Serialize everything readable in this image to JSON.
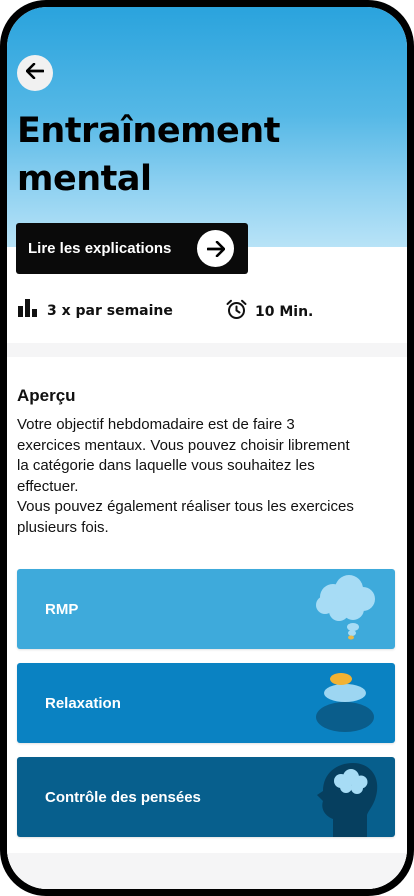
{
  "header": {
    "back_icon": "arrow-left-icon",
    "title": "Entraînement mental",
    "explain_button": {
      "label": "Lire les explications",
      "icon": "arrow-right-icon"
    }
  },
  "stats": [
    {
      "icon": "bar-chart-icon",
      "label": "3 x par semaine"
    },
    {
      "icon": "alarm-clock-icon",
      "label": "10 Min."
    }
  ],
  "overview": {
    "title": "Aperçu",
    "paragraphs": [
      "Votre objectif hebdomadaire est de faire 3 exercices mentaux. Vous pouvez choisir librement la catégorie dans laquelle vous souhaitez les effectuer.",
      "Vous pouvez également réaliser tous les exercices plusieurs fois."
    ]
  },
  "categories": [
    {
      "label": "RMP",
      "color": "#3eaadb",
      "illustration": "thought-cloud-icon"
    },
    {
      "label": "Relaxation",
      "color": "#0a82c2",
      "illustration": "balanced-stones-icon"
    },
    {
      "label": "Contrôle des pensées",
      "color": "#075f8d",
      "illustration": "head-with-cloud-icon"
    }
  ],
  "colors": {
    "background": "#f5f5f6",
    "button": "#0a0a0a",
    "hero_top": "#2aa3dd"
  }
}
